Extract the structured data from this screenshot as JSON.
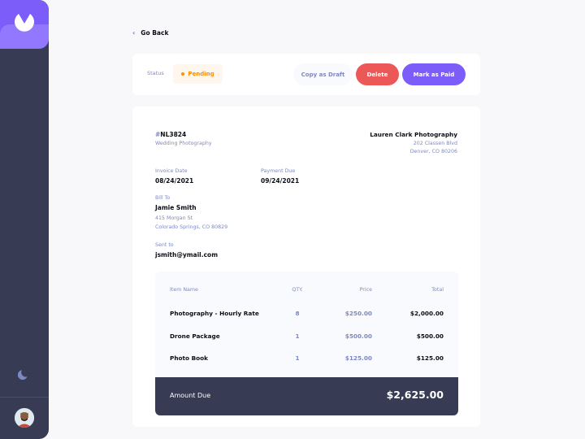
{
  "sidebar": {
    "logo_icon": "logo-icon",
    "theme_icon": "moon-icon",
    "avatar": "avatar"
  },
  "nav": {
    "go_back": "Go Back"
  },
  "status": {
    "label": "Status",
    "value": "Pending",
    "color": "#ff8f00"
  },
  "actions": {
    "draft": "Copy as Draft",
    "delete": "Delete",
    "paid": "Mark as Paid"
  },
  "invoice": {
    "hash": "#",
    "id": "NL3824",
    "description": "Wedding Photography",
    "sender": {
      "name": "Lauren Clark Photography",
      "street": "202 Classen Blvd",
      "city": "Denver, CO 80206"
    },
    "invoice_date_label": "Invoice Date",
    "invoice_date": "08/24/2021",
    "payment_due_label": "Payment Due",
    "payment_due": "09/24/2021",
    "bill_to_label": "Bill To",
    "client_name": "Jamie Smith",
    "client_street": "415 Morgan St",
    "client_city": "Colorado Springs, CO 80829",
    "sent_to_label": "Sent to",
    "client_email": "jsmith@ymail.com"
  },
  "items": {
    "headers": [
      "Item Name",
      "QTY.",
      "Price",
      "Total"
    ],
    "rows": [
      {
        "name": "Photography - Hourly Rate",
        "qty": "8",
        "price": "$250.00",
        "total": "$2,000.00"
      },
      {
        "name": "Drone Package",
        "qty": "1",
        "price": "$500.00",
        "total": "$500.00"
      },
      {
        "name": "Photo Book",
        "qty": "1",
        "price": "$125.00",
        "total": "$125.00"
      }
    ],
    "amount_due_label": "Amount Due",
    "amount_due": "$2,625.00"
  },
  "colors": {
    "accent": "#7c5dfa",
    "danger": "#ec5757",
    "sidebar": "#373b53",
    "muted": "#7e88c3"
  }
}
